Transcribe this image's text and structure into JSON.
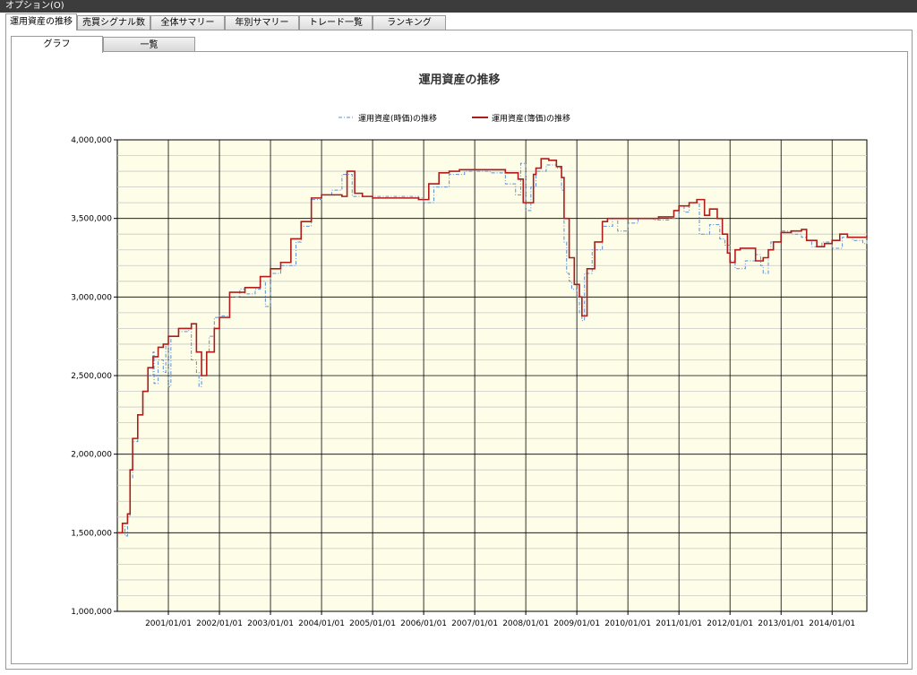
{
  "menu": {
    "options_label": "オプション(O)"
  },
  "tabs": [
    {
      "label": "運用資産の推移",
      "active": true
    },
    {
      "label": "売買シグナル数",
      "active": false
    },
    {
      "label": "全体サマリー",
      "active": false
    },
    {
      "label": "年別サマリー",
      "active": false
    },
    {
      "label": "トレード一覧",
      "active": false
    },
    {
      "label": "ランキング",
      "active": false
    }
  ],
  "subtabs": [
    {
      "label": "グラフ",
      "active": true
    },
    {
      "label": "一覧",
      "active": false
    }
  ],
  "colors": {
    "plot_bg": "#fdfde8",
    "market_line": "#5b8fd6",
    "book_line": "#b01c1c",
    "grid": "#000000"
  },
  "chart_data": {
    "type": "line",
    "title": "運用資産の推移",
    "legend_position": "top",
    "grid": true,
    "ylim": [
      1000000,
      4000000
    ],
    "yticks": [
      {
        "v": 1000000,
        "label": "1,000,000"
      },
      {
        "v": 1500000,
        "label": "1,500,000"
      },
      {
        "v": 2000000,
        "label": "2,000,000"
      },
      {
        "v": 2500000,
        "label": "2,500,000"
      },
      {
        "v": 3000000,
        "label": "3,000,000"
      },
      {
        "v": 3500000,
        "label": "3,500,000"
      },
      {
        "v": 4000000,
        "label": "4,000,000"
      }
    ],
    "xlim": [
      2000.0,
      2014.68
    ],
    "xticks": [
      {
        "v": 2001,
        "label": "2001/01/01"
      },
      {
        "v": 2002,
        "label": "2002/01/01"
      },
      {
        "v": 2003,
        "label": "2003/01/01"
      },
      {
        "v": 2004,
        "label": "2004/01/01"
      },
      {
        "v": 2005,
        "label": "2005/01/01"
      },
      {
        "v": 2006,
        "label": "2006/01/01"
      },
      {
        "v": 2007,
        "label": "2007/01/01"
      },
      {
        "v": 2008,
        "label": "2008/01/01"
      },
      {
        "v": 2009,
        "label": "2009/01/01"
      },
      {
        "v": 2010,
        "label": "2010/01/01"
      },
      {
        "v": 2011,
        "label": "2011/01/01"
      },
      {
        "v": 2012,
        "label": "2012/01/01"
      },
      {
        "v": 2013,
        "label": "2013/01/01"
      },
      {
        "v": 2014,
        "label": "2014/01/01"
      }
    ],
    "series": [
      {
        "name": "運用資産(時価)の推移",
        "style": "dash-dot",
        "x": [
          2000.0,
          2000.1,
          2000.15,
          2000.2,
          2000.25,
          2000.3,
          2000.4,
          2000.5,
          2000.6,
          2000.7,
          2000.72,
          2000.8,
          2000.9,
          2000.95,
          2001.0,
          2001.05,
          2001.2,
          2001.4,
          2001.45,
          2001.55,
          2001.6,
          2001.65,
          2001.75,
          2001.8,
          2001.9,
          2002.0,
          2002.2,
          2002.4,
          2002.5,
          2002.7,
          2002.8,
          2002.9,
          2003.0,
          2003.2,
          2003.5,
          2003.6,
          2003.8,
          2004.0,
          2004.2,
          2004.4,
          2004.6,
          2004.8,
          2005.0,
          2005.5,
          2005.9,
          2006.0,
          2006.2,
          2006.5,
          2006.8,
          2007.0,
          2007.3,
          2007.6,
          2007.8,
          2007.9,
          2008.0,
          2008.1,
          2008.2,
          2008.4,
          2008.6,
          2008.7,
          2008.75,
          2008.8,
          2008.85,
          2008.9,
          2009.0,
          2009.05,
          2009.1,
          2009.15,
          2009.3,
          2009.5,
          2009.7,
          2009.8,
          2010.0,
          2010.2,
          2010.5,
          2010.8,
          2011.0,
          2011.1,
          2011.2,
          2011.4,
          2011.6,
          2011.8,
          2011.9,
          2012.0,
          2012.1,
          2012.3,
          2012.5,
          2012.6,
          2012.65,
          2012.75,
          2012.8,
          2013.0,
          2013.2,
          2013.4,
          2013.5,
          2013.6,
          2013.8,
          2014.0,
          2014.2,
          2014.4,
          2014.6,
          2014.68
        ],
        "y": [
          1500000,
          1540000,
          1480000,
          1600000,
          1850000,
          2080000,
          2250000,
          2400000,
          2500000,
          2650000,
          2450000,
          2600000,
          2520000,
          2700000,
          2430000,
          2750000,
          2780000,
          2800000,
          2600000,
          2520000,
          2430000,
          2600000,
          2650000,
          2750000,
          2870000,
          2880000,
          3000000,
          3050000,
          3020000,
          3050000,
          3100000,
          2940000,
          3150000,
          3200000,
          3350000,
          3450000,
          3620000,
          3650000,
          3680000,
          3780000,
          3640000,
          3640000,
          3640000,
          3640000,
          3630000,
          3600000,
          3700000,
          3780000,
          3800000,
          3800000,
          3790000,
          3720000,
          3650000,
          3850000,
          3550000,
          3700000,
          3800000,
          3840000,
          3820000,
          3680000,
          3350000,
          3150000,
          3100000,
          3050000,
          3000000,
          2900000,
          2850000,
          3150000,
          3300000,
          3450000,
          3500000,
          3420000,
          3470000,
          3500000,
          3490000,
          3500000,
          3580000,
          3540000,
          3600000,
          3400000,
          3460000,
          3370000,
          3330000,
          3230000,
          3180000,
          3230000,
          3270000,
          3200000,
          3150000,
          3300000,
          3350000,
          3420000,
          3400000,
          3380000,
          3360000,
          3320000,
          3350000,
          3310000,
          3380000,
          3360000,
          3340000,
          3380000
        ]
      },
      {
        "name": "運用資産(簿価)の推移",
        "style": "solid",
        "x": [
          2000.0,
          2000.1,
          2000.2,
          2000.25,
          2000.3,
          2000.4,
          2000.5,
          2000.6,
          2000.7,
          2000.8,
          2000.9,
          2001.0,
          2001.2,
          2001.45,
          2001.55,
          2001.65,
          2001.75,
          2001.9,
          2002.0,
          2002.2,
          2002.5,
          2002.8,
          2003.0,
          2003.2,
          2003.4,
          2003.6,
          2003.8,
          2004.0,
          2004.4,
          2004.5,
          2004.65,
          2004.8,
          2005.0,
          2005.5,
          2005.9,
          2006.0,
          2006.1,
          2006.3,
          2006.5,
          2006.7,
          2006.9,
          2007.0,
          2007.3,
          2007.6,
          2007.85,
          2007.95,
          2008.05,
          2008.15,
          2008.2,
          2008.3,
          2008.45,
          2008.6,
          2008.7,
          2008.75,
          2008.85,
          2008.95,
          2009.05,
          2009.1,
          2009.2,
          2009.35,
          2009.5,
          2009.6,
          2009.75,
          2010.0,
          2010.4,
          2010.6,
          2010.9,
          2011.0,
          2011.2,
          2011.35,
          2011.5,
          2011.6,
          2011.75,
          2011.85,
          2011.95,
          2012.0,
          2012.1,
          2012.2,
          2012.5,
          2012.65,
          2012.75,
          2012.85,
          2013.0,
          2013.2,
          2013.4,
          2013.5,
          2013.7,
          2013.85,
          2014.0,
          2014.15,
          2014.3,
          2014.5,
          2014.68
        ],
        "y": [
          1500000,
          1560000,
          1620000,
          1900000,
          2100000,
          2250000,
          2400000,
          2550000,
          2620000,
          2680000,
          2700000,
          2750000,
          2800000,
          2830000,
          2650000,
          2500000,
          2650000,
          2800000,
          2870000,
          3030000,
          3060000,
          3130000,
          3180000,
          3220000,
          3370000,
          3480000,
          3630000,
          3650000,
          3640000,
          3800000,
          3660000,
          3640000,
          3630000,
          3630000,
          3620000,
          3620000,
          3720000,
          3790000,
          3800000,
          3810000,
          3810000,
          3810000,
          3810000,
          3790000,
          3750000,
          3600000,
          3600000,
          3780000,
          3820000,
          3880000,
          3870000,
          3830000,
          3760000,
          3500000,
          3250000,
          3080000,
          3000000,
          2880000,
          3180000,
          3350000,
          3480000,
          3500000,
          3500000,
          3500000,
          3500000,
          3510000,
          3550000,
          3580000,
          3600000,
          3620000,
          3520000,
          3560000,
          3500000,
          3400000,
          3280000,
          3220000,
          3300000,
          3310000,
          3230000,
          3250000,
          3300000,
          3350000,
          3410000,
          3420000,
          3430000,
          3360000,
          3320000,
          3340000,
          3360000,
          3400000,
          3380000,
          3380000,
          3390000
        ]
      }
    ]
  }
}
